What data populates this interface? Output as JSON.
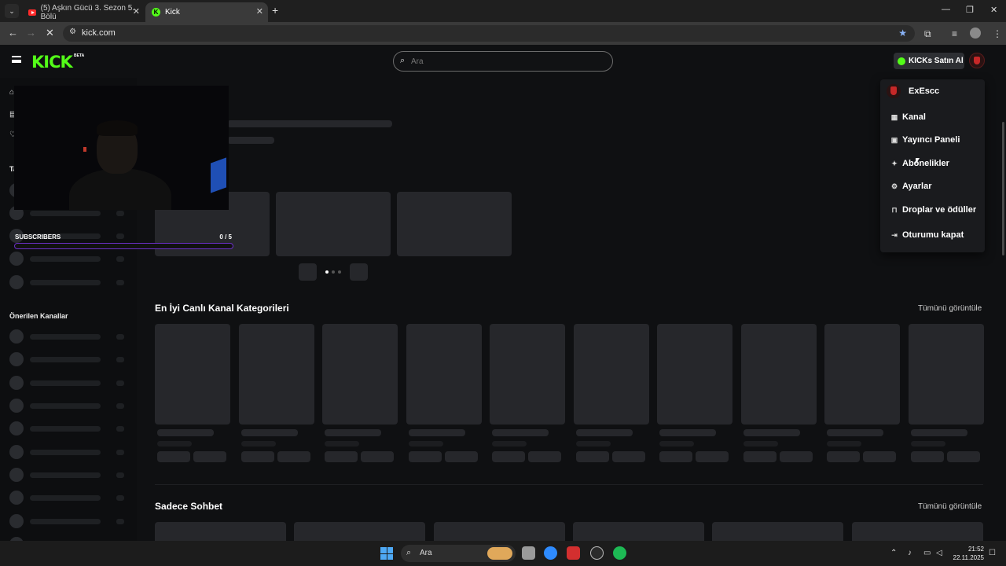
{
  "browser": {
    "tabs": [
      {
        "title": "(5) Aşkın Gücü 3. Sezon 5. Bölü"
      },
      {
        "title": "Kick"
      }
    ],
    "url": "kick.com"
  },
  "site": {
    "logo": "KICK",
    "beta": "BETA",
    "search_placeholder": "Ara",
    "kicks_button": "KICKs Satın Al"
  },
  "sidebar": {
    "section_following_short": "Ta",
    "recommended_title": "Önerilen Kanallar"
  },
  "overlay": {
    "subscribers_label": "SUBSCRIBERS",
    "subscribers_count": "0 / 5",
    "subscribers_progress": 0
  },
  "sections": {
    "categories_title": "En İyi Canlı Kanal Kategorileri",
    "categories_view_all": "Tümünü görüntüle",
    "chat_title": "Sadece Sohbet",
    "chat_view_all": "Tümünü görüntüle"
  },
  "user_menu": {
    "username": "ExEscc",
    "items": [
      {
        "label": "Kanal",
        "icon": "channel-icon"
      },
      {
        "label": "Yayıncı Paneli",
        "icon": "dashboard-icon"
      },
      {
        "label": "Abonelikler",
        "icon": "sparkle-icon"
      },
      {
        "label": "Ayarlar",
        "icon": "gear-icon"
      },
      {
        "label": "Droplar ve ödüller",
        "icon": "gift-icon"
      },
      {
        "label": "Oturumu kapat",
        "icon": "logout-icon"
      }
    ]
  },
  "taskbar": {
    "search_label": "Ara",
    "time": "21:52",
    "date": "22.11.2025"
  },
  "colors": {
    "kick_green": "#53fc18",
    "subscriber_bar": "#6a2fc4"
  }
}
